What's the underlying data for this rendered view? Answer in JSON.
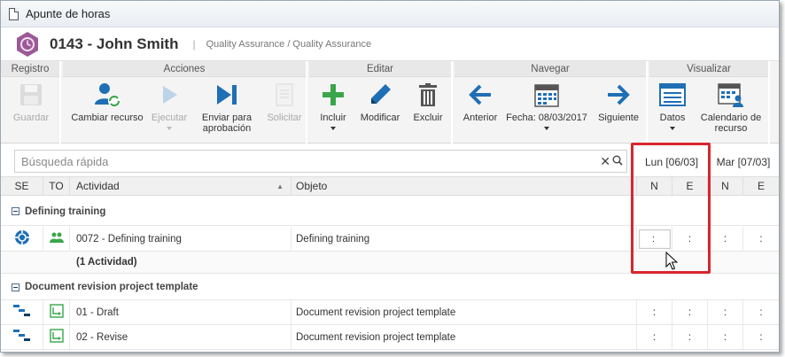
{
  "window": {
    "title": "Apunte de horas"
  },
  "header": {
    "record_title": "0143 - John Smith",
    "separator": "|",
    "subtitle": "Quality Assurance / Quality Assurance"
  },
  "toolbar": {
    "groups": [
      {
        "title": "Registro",
        "buttons": [
          {
            "label": "Guardar",
            "icon": "save-icon",
            "disabled": true
          }
        ]
      },
      {
        "title": "Acciones",
        "buttons": [
          {
            "label": "Cambiar recurso",
            "icon": "change-resource-icon"
          },
          {
            "label": "Ejecutar",
            "icon": "play-icon",
            "disabled": true
          },
          {
            "label": "Enviar para aprobación",
            "icon": "send-approval-icon"
          },
          {
            "label": "Solicitar",
            "icon": "request-icon",
            "disabled": true
          }
        ]
      },
      {
        "title": "Editar",
        "buttons": [
          {
            "label": "Incluir",
            "icon": "plus-icon"
          },
          {
            "label": "Modificar",
            "icon": "pencil-icon"
          },
          {
            "label": "Excluir",
            "icon": "trash-icon"
          }
        ]
      },
      {
        "title": "Navegar",
        "buttons": [
          {
            "label": "Anterior",
            "icon": "arrow-left-icon"
          },
          {
            "label": "Fecha: 08/03/2017",
            "icon": "calendar-icon"
          },
          {
            "label": "Siguiente",
            "icon": "arrow-right-icon"
          }
        ]
      },
      {
        "title": "Visualizar",
        "buttons": [
          {
            "label": "Datos",
            "icon": "data-view-icon"
          },
          {
            "label": "Calendario de recurso",
            "icon": "resource-calendar-icon"
          }
        ]
      }
    ]
  },
  "search": {
    "placeholder": "Búsqueda rápida",
    "value": ""
  },
  "grid": {
    "dates": [
      "Lun [06/03]",
      "Mar [07/03]"
    ],
    "columns": {
      "se": "SE",
      "to": "TO",
      "activity": "Actividad",
      "object": "Objeto",
      "n": "N",
      "e": "E"
    },
    "groups": [
      {
        "title": "Defining training",
        "rows": [
          {
            "activity": "0072 - Defining training",
            "object": "Defining training",
            "times": [
              ":",
              ":",
              ":",
              ":"
            ]
          }
        ],
        "summary": "(1 Actividad)"
      },
      {
        "title": "Document revision project template",
        "rows": [
          {
            "activity": "01 - Draft",
            "object": "Document revision project template",
            "times": [
              ":",
              ":",
              ":",
              ":"
            ]
          },
          {
            "activity": "02 - Revise",
            "object": "Document revision project template",
            "times": [
              ":",
              ":",
              ":",
              ":"
            ]
          }
        ]
      }
    ],
    "editing_value": ":"
  },
  "colors": {
    "accent": "#1f6fb5",
    "highlight": "#d7262d",
    "green": "#3aa64a"
  }
}
